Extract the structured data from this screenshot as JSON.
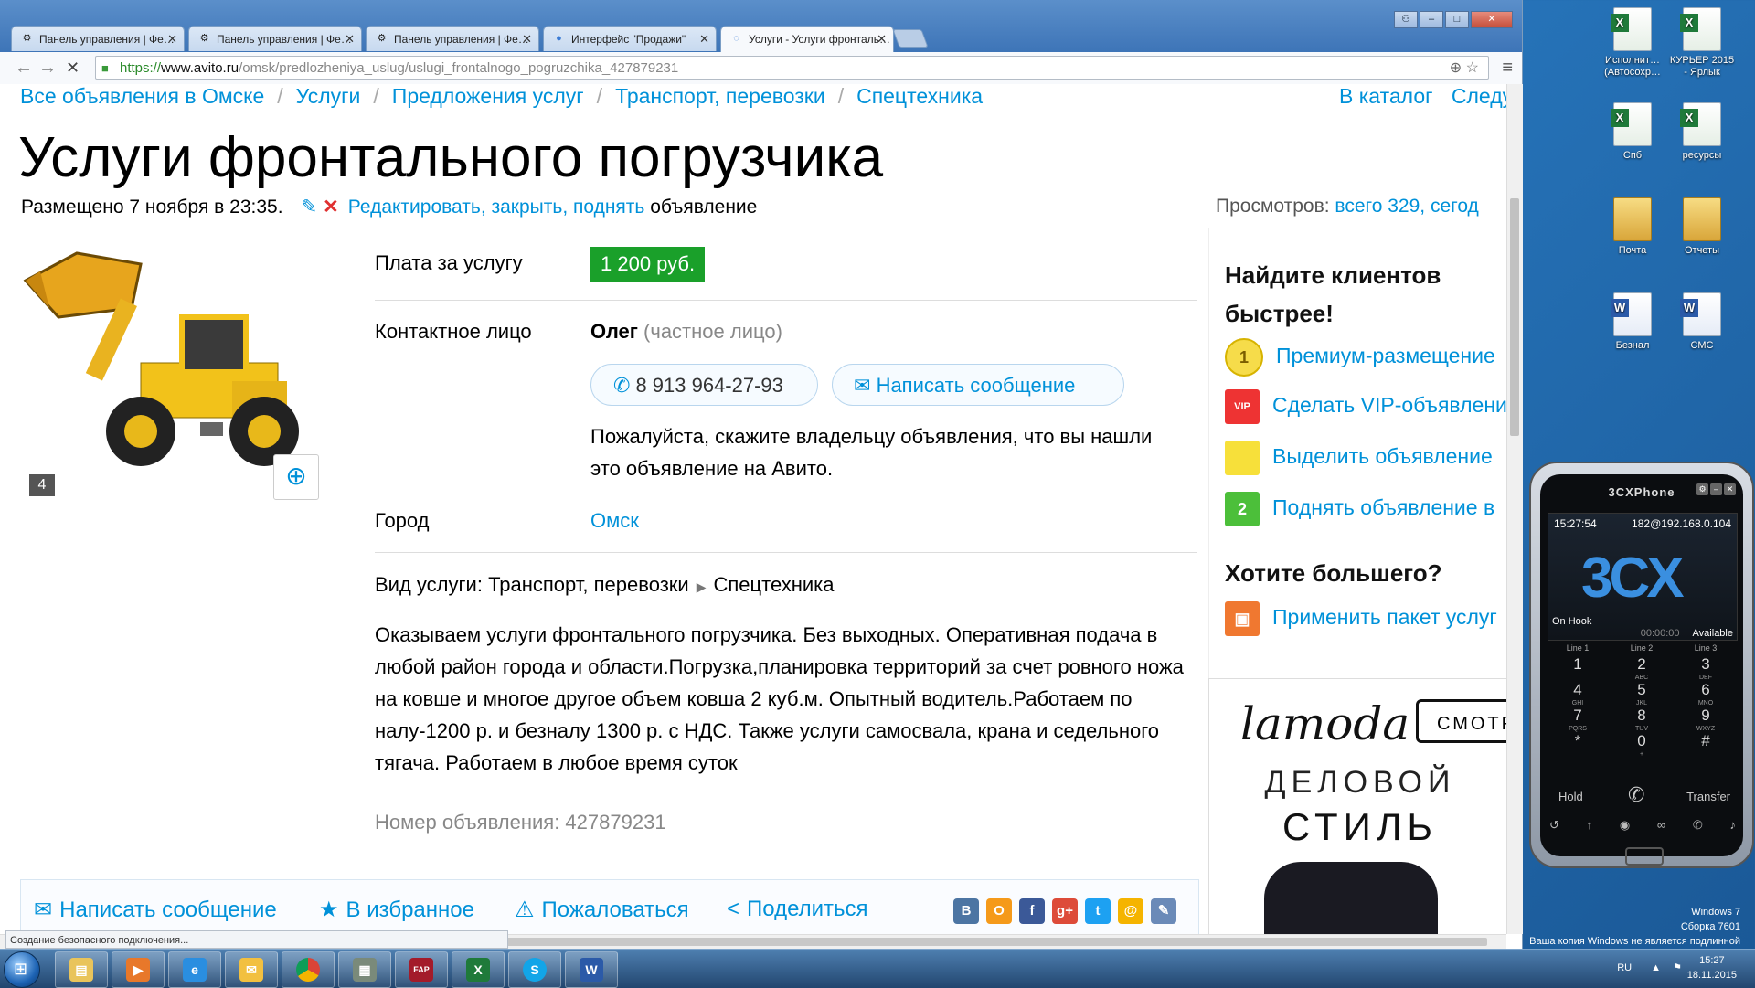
{
  "tabs": [
    {
      "label": "Панель управления | Фе…"
    },
    {
      "label": "Панель управления | Фе…"
    },
    {
      "label": "Панель управления | Фе…"
    },
    {
      "label": "Интерфейс \"Продажи\""
    },
    {
      "label": "Услуги - Услуги фронталь…"
    }
  ],
  "address": {
    "https": "https://",
    "host": "www.avito.ru",
    "path": "/omsk/predlozheniya_uslug/uslugi_frontalnogo_pogruzchika_427879231"
  },
  "breadcrumbs": [
    "Все объявления в Омске",
    "Услуги",
    "Предложения услуг",
    "Транспорт, перевозки",
    "Спецтехника"
  ],
  "breadcrumbs_right": {
    "catalog": "В каталог",
    "next": "Следу"
  },
  "title": "Услуги фронтального погрузчика",
  "meta": {
    "posted": "Размещено 7 ноября в 23:35.",
    "edit_link": "Редактировать, закрыть, поднять",
    "edit_suffix": "объявление"
  },
  "views": {
    "label": "Просмотров:",
    "value": "всего 329, сегод"
  },
  "photo": {
    "count": "4"
  },
  "params": {
    "price_label": "Плата за услугу",
    "price": "1 200 руб.",
    "contact_label": "Контактное лицо",
    "contact_name": "Олег",
    "contact_type": "(частное лицо)",
    "phone": "8 913 964-27-93",
    "message_button": "Написать сообщение",
    "please_text": "Пожалуйста, скажите владельцу объявления, что вы нашли это объявление на Авито.",
    "city_label": "Город",
    "city": "Омск",
    "service_label": "Вид услуги:",
    "service_cat1": "Транспорт, перевозки",
    "service_cat2": "Спецтехника"
  },
  "description": "Оказываем услуги фронтального погрузчика. Без выходных. Оперативная подача в любой район города и области.Погрузка,планировка территорий за счет ровного ножа на ковше и многое другое объем ковша 2 куб.м. Опытный водитель.Работаем по налу-1200 р. и безналу 1300 р. с НДС. Также услуги самосвала, крана и седельного тягача. Работаем в любое время суток",
  "ad_number": "Номер объявления: 427879231",
  "actions": {
    "message": "Написать сообщение",
    "favorite": "В избранное",
    "complain": "Пожаловаться",
    "share": "Поделиться"
  },
  "share_icons": [
    "В",
    "О",
    "f",
    "g+",
    "t",
    "@",
    "✎"
  ],
  "promo": {
    "title": "Найдите клиентов быстрее!",
    "items": [
      {
        "label": "Премиум-размещение",
        "badge": "1"
      },
      {
        "label": "Сделать VIP-объявлени",
        "badge": "VIP"
      },
      {
        "label": "Выделить объявление",
        "badge": ""
      },
      {
        "label": "Поднять объявление в",
        "badge": "2"
      }
    ],
    "more_title": "Хотите большего?",
    "more_item": "Применить пакет услуг"
  },
  "banner": {
    "brand": "lamoda",
    "button": "СМОТР",
    "line1": "ДЕЛОВОЙ",
    "line2": "СТИЛЬ"
  },
  "statusbar": "Создание безопасного подключения...",
  "desktop_icons": [
    {
      "label": "Исполнит… (Автосохр…",
      "type": "xl"
    },
    {
      "label": "КУРЬЕР 2015 - Ярлык",
      "type": "xl"
    },
    {
      "label": "Спб",
      "type": "xl"
    },
    {
      "label": "ресурсы",
      "type": "xl"
    },
    {
      "label": "Почта",
      "type": "fd"
    },
    {
      "label": "Отчеты",
      "type": "fd"
    },
    {
      "label": "Безнал",
      "type": "wd"
    },
    {
      "label": "СМС",
      "type": "wd"
    }
  ],
  "phone": {
    "title": "3CXPhone",
    "time": "15:27:54",
    "extension": "182@192.168.0.104",
    "logo": "3CX",
    "status": "On Hook",
    "timer": "00:00:00",
    "availability": "Available",
    "lines": [
      "Line 1",
      "Line 2",
      "Line 3"
    ],
    "keys": [
      {
        "d": "1",
        "s": ""
      },
      {
        "d": "2",
        "s": "ABC"
      },
      {
        "d": "3",
        "s": "DEF"
      },
      {
        "d": "4",
        "s": "GHI"
      },
      {
        "d": "5",
        "s": "JKL"
      },
      {
        "d": "6",
        "s": "MNO"
      },
      {
        "d": "7",
        "s": "PQRS"
      },
      {
        "d": "8",
        "s": "TUV"
      },
      {
        "d": "9",
        "s": "WXYZ"
      },
      {
        "d": "*",
        "s": ""
      },
      {
        "d": "0",
        "s": "+"
      },
      {
        "d": "#",
        "s": ""
      }
    ],
    "hold": "Hold",
    "transfer": "Transfer"
  },
  "watermark": {
    "line1": "Windows 7",
    "line2": "Сборка 7601",
    "line3": "Ваша копия Windows не является подлинной"
  },
  "taskbar": {
    "lang": "RU",
    "time": "15:27",
    "date": "18.11.2015"
  }
}
